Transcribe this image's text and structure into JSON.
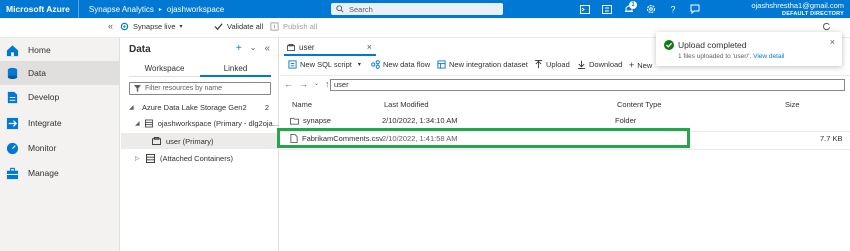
{
  "topbar": {
    "brand": "Microsoft Azure",
    "breadcrumb": [
      "Synapse Analytics",
      "ojashworkspace"
    ],
    "search_placeholder": "Search",
    "notification_count": "1",
    "account_email": "ojashshrestha1@gmail.com",
    "account_directory": "DEFAULT DIRECTORY"
  },
  "cmdbar": {
    "synapse_live": "Synapse live",
    "validate_all": "Validate all",
    "publish_all": "Publish all"
  },
  "leftnav": {
    "items": [
      {
        "label": "Home",
        "icon": "home-icon"
      },
      {
        "label": "Data",
        "icon": "database-icon"
      },
      {
        "label": "Develop",
        "icon": "document-icon"
      },
      {
        "label": "Integrate",
        "icon": "pipeline-icon"
      },
      {
        "label": "Monitor",
        "icon": "gauge-icon"
      },
      {
        "label": "Manage",
        "icon": "toolbox-icon"
      }
    ],
    "active": "Data"
  },
  "datapanel": {
    "title": "Data",
    "tabs": [
      "Workspace",
      "Linked"
    ],
    "active_tab": "Linked",
    "filter_placeholder": "Filter resources by name",
    "tree": [
      {
        "label": "Azure Data Lake Storage Gen2",
        "count": "2"
      },
      {
        "label": "ojashworkspace (Primary - dlg2oja...",
        "count": ""
      },
      {
        "label": "user (Primary)",
        "count": ""
      },
      {
        "label": "(Attached Containers)",
        "count": ""
      }
    ]
  },
  "main": {
    "tab_label": "user",
    "toolbar": {
      "new_sql_script": "New SQL script",
      "new_data_flow": "New data flow",
      "new_integration_dataset": "New integration dataset",
      "upload": "Upload",
      "download": "Download",
      "new": "New"
    },
    "path": "user",
    "columns": [
      "Name",
      "Last Modified",
      "Content Type",
      "Size"
    ],
    "rows": [
      {
        "name": "synapse",
        "modified": "2/10/2022, 1:34:10 AM",
        "type": "Folder",
        "size": ""
      },
      {
        "name": "FabrikamComments.csv",
        "modified": "2/10/2022, 1:41:58 AM",
        "type": "",
        "size": "7.7 KB"
      }
    ]
  },
  "toast": {
    "title": "Upload completed",
    "message": "1 files uploaded to 'user/'.",
    "link": "View detail"
  },
  "colors": {
    "accent": "#0078d4",
    "highlight": "#22a84a",
    "success": "#107c10"
  }
}
